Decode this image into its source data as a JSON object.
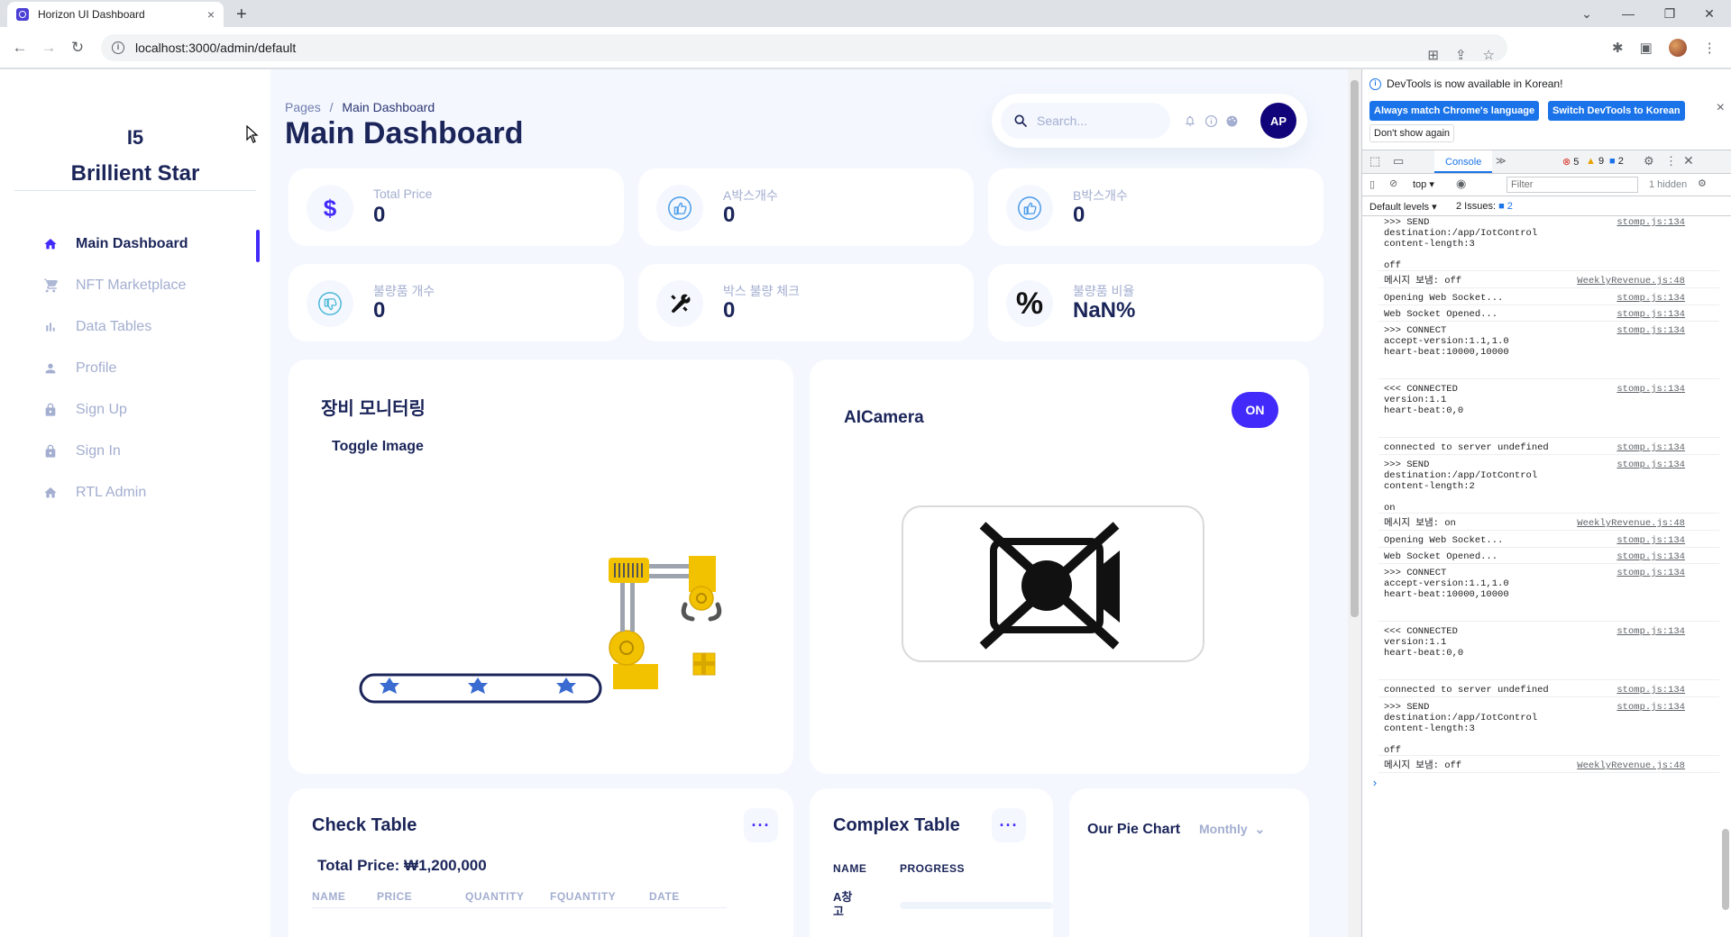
{
  "browser": {
    "tab_title": "Horizon UI Dashboard",
    "url": "localhost:3000/admin/default",
    "new_tab": "+",
    "tab_close": "×",
    "win_min": "—",
    "win_restore": "❐",
    "win_close": "✕",
    "win_chevron": "⌄"
  },
  "sidebar": {
    "brand_code": "I5",
    "brand_name": "Brillient Star",
    "items": [
      {
        "label": "Main Dashboard",
        "icon": "home-icon",
        "active": true
      },
      {
        "label": "NFT Marketplace",
        "icon": "cart-icon"
      },
      {
        "label": "Data Tables",
        "icon": "bar-chart-icon"
      },
      {
        "label": "Profile",
        "icon": "person-icon"
      },
      {
        "label": "Sign Up",
        "icon": "lock-icon"
      },
      {
        "label": "Sign In",
        "icon": "lock-icon"
      },
      {
        "label": "RTL Admin",
        "icon": "home-icon"
      }
    ]
  },
  "header": {
    "breadcrumb_root": "Pages",
    "breadcrumb_sep": "/",
    "breadcrumb_current": "Main Dashboard",
    "title": "Main Dashboard",
    "search_placeholder": "Search...",
    "avatar_initials": "AP"
  },
  "stats": [
    {
      "label": "Total Price",
      "value": "0",
      "icon": "dollar-icon"
    },
    {
      "label": "A박스개수",
      "value": "0",
      "icon": "thumbs-up-icon"
    },
    {
      "label": "B박스개수",
      "value": "0",
      "icon": "thumbs-up-icon"
    },
    {
      "label": "불량품 개수",
      "value": "0",
      "icon": "thumbs-down-icon"
    },
    {
      "label": "박스 불량 체크",
      "value": "0",
      "icon": "tools-icon"
    },
    {
      "label": "불량품 비율",
      "value": "NaN%",
      "icon": "percent-icon"
    }
  ],
  "monitoring": {
    "title": "장비 모니터링",
    "toggle_label": "Toggle Image"
  },
  "camera": {
    "title": "AICamera",
    "on_label": "ON"
  },
  "check_table": {
    "title": "Check Table",
    "total_price": "Total Price: ₩1,200,000",
    "columns": [
      "NAME",
      "PRICE",
      "QUANTITY",
      "FQUANTITY",
      "DATE"
    ]
  },
  "complex_table": {
    "title": "Complex Table",
    "columns": [
      "NAME",
      "PROGRESS"
    ],
    "rows": [
      {
        "name": "A창\n고",
        "progress": 0
      }
    ]
  },
  "pie_chart": {
    "title": "Our Pie Chart",
    "period": "Monthly"
  },
  "devtools": {
    "notice": "DevTools is now available in Korean!",
    "btn_match": "Always match Chrome's language",
    "btn_switch": "Switch DevTools to Korean",
    "btn_dont": "Don't show again",
    "tab_console": "Console",
    "more_tabs": "≫",
    "errors": "5",
    "warnings": "9",
    "infos": "2",
    "context": "top",
    "filter_placeholder": "Filter",
    "hidden": "1 hidden",
    "default_levels": "Default levels",
    "issues_label": "2 Issues:",
    "issues_count": "2",
    "logs": [
      {
        "text": ">>> SEND\ndestination:/app/IotControl\ncontent-length:3\n\noff",
        "src": "stomp.js:134"
      },
      {
        "text": "메시지 보냄: off",
        "src": "WeeklyRevenue.js:48"
      },
      {
        "text": "Opening Web Socket...",
        "src": "stomp.js:134"
      },
      {
        "text": "Web Socket Opened...",
        "src": "stomp.js:134"
      },
      {
        "text": ">>> CONNECT\naccept-version:1.1,1.0\nheart-beat:10000,10000",
        "src": "stomp.js:134"
      },
      {
        "text": "<<< CONNECTED\nversion:1.1\nheart-beat:0,0",
        "src": "stomp.js:134"
      },
      {
        "text": "connected to server undefined",
        "src": "stomp.js:134"
      },
      {
        "text": ">>> SEND\ndestination:/app/IotControl\ncontent-length:2\n\non",
        "src": "stomp.js:134"
      },
      {
        "text": "메시지 보냄: on",
        "src": "WeeklyRevenue.js:48"
      },
      {
        "text": "Opening Web Socket...",
        "src": "stomp.js:134"
      },
      {
        "text": "Web Socket Opened...",
        "src": "stomp.js:134"
      },
      {
        "text": ">>> CONNECT\naccept-version:1.1,1.0\nheart-beat:10000,10000",
        "src": "stomp.js:134"
      },
      {
        "text": "<<< CONNECTED\nversion:1.1\nheart-beat:0,0",
        "src": "stomp.js:134"
      },
      {
        "text": "connected to server undefined",
        "src": "stomp.js:134"
      },
      {
        "text": ">>> SEND\ndestination:/app/IotControl\ncontent-length:3\n\noff",
        "src": "stomp.js:134"
      },
      {
        "text": "메시지 보냄: off",
        "src": "WeeklyRevenue.js:48"
      }
    ],
    "prompt": "›"
  },
  "colors": {
    "brand": "#422afb",
    "navy": "#1b2559",
    "muted": "#a3aed0",
    "bg": "#f4f7fe",
    "machine_yellow": "#f2c200",
    "belt_blue": "#3a6bd1"
  }
}
